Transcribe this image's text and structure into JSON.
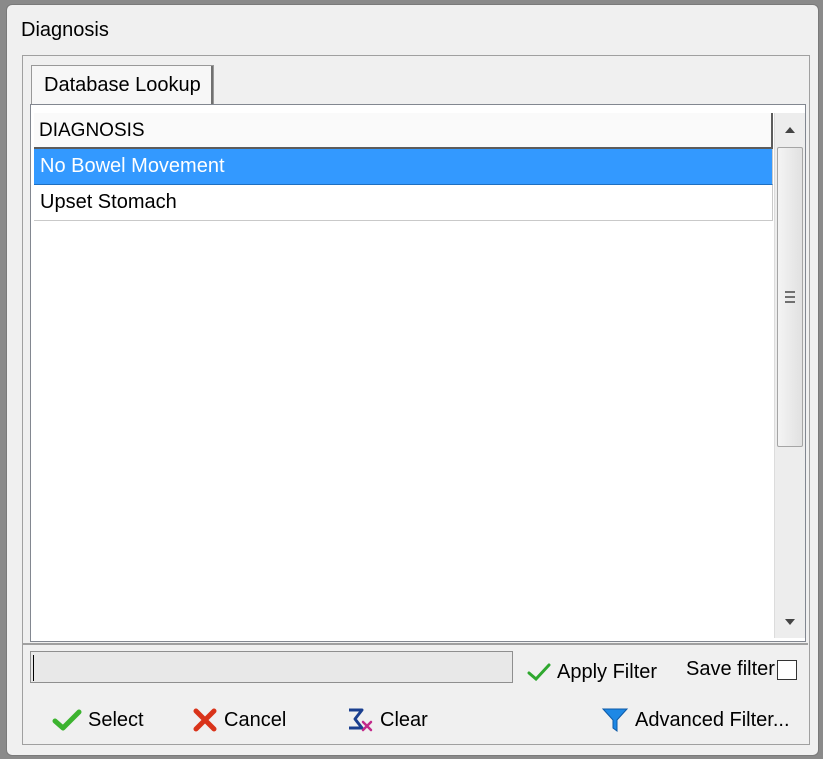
{
  "window": {
    "title": "Diagnosis"
  },
  "tabs": [
    {
      "label": "Database Lookup"
    }
  ],
  "grid": {
    "column_header": "DIAGNOSIS",
    "rows": [
      {
        "label": "No Bowel Movement",
        "selected": true
      },
      {
        "label": "Upset Stomach",
        "selected": false
      }
    ]
  },
  "filter": {
    "input_value": "",
    "apply_label": "Apply Filter",
    "save_label": "Save filter",
    "save_checked": false
  },
  "buttons": {
    "select": "Select",
    "cancel": "Cancel",
    "clear": "Clear",
    "advanced": "Advanced Filter..."
  },
  "colors": {
    "selection": "#3399ff",
    "check_green": "#2fa82f",
    "cancel_red": "#d9331a",
    "funnel_blue": "#1e88e5"
  },
  "icons": [
    "checkmark-icon",
    "cancel-x-icon",
    "sigma-clear-icon",
    "funnel-icon",
    "scroll-up-icon",
    "scroll-down-icon"
  ]
}
